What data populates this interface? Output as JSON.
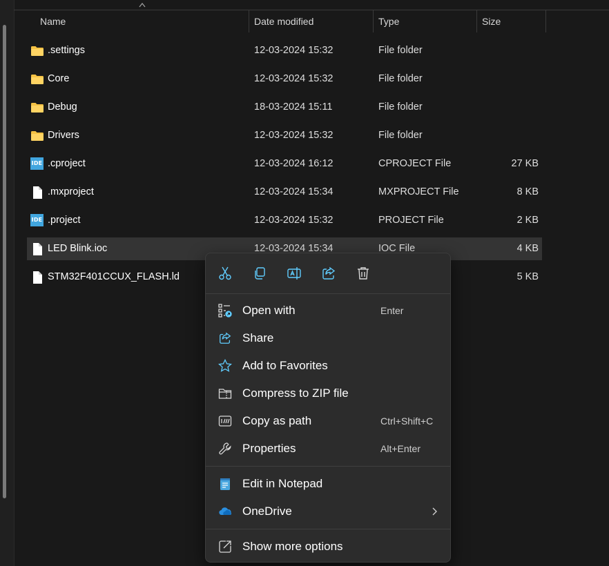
{
  "columns": {
    "name": "Name",
    "date": "Date modified",
    "type": "Type",
    "size": "Size"
  },
  "files": [
    {
      "name": ".settings",
      "date": "12-03-2024 15:32",
      "type": "File folder",
      "size": "",
      "icon": "folder-icon"
    },
    {
      "name": "Core",
      "date": "12-03-2024 15:32",
      "type": "File folder",
      "size": "",
      "icon": "folder-icon"
    },
    {
      "name": "Debug",
      "date": "18-03-2024 15:11",
      "type": "File folder",
      "size": "",
      "icon": "folder-icon"
    },
    {
      "name": "Drivers",
      "date": "12-03-2024 15:32",
      "type": "File folder",
      "size": "",
      "icon": "folder-icon"
    },
    {
      "name": ".cproject",
      "date": "12-03-2024 16:12",
      "type": "CPROJECT File",
      "size": "27 KB",
      "icon": "ide-file-icon",
      "badge": "IDE"
    },
    {
      "name": ".mxproject",
      "date": "12-03-2024 15:34",
      "type": "MXPROJECT File",
      "size": "8 KB",
      "icon": "file-icon"
    },
    {
      "name": ".project",
      "date": "12-03-2024 15:32",
      "type": "PROJECT File",
      "size": "2 KB",
      "icon": "ide-file-icon",
      "badge": "IDE"
    },
    {
      "name": "LED Blink.ioc",
      "date": "12-03-2024 15:34",
      "type": "IOC File",
      "size": "4 KB",
      "icon": "file-icon"
    },
    {
      "name": "STM32F401CCUX_FLASH.ld",
      "date": "",
      "type": "",
      "size": "5 KB",
      "icon": "file-icon"
    }
  ],
  "selected_index": 7,
  "context_menu": {
    "toolbar": [
      "cut-icon",
      "copy-icon",
      "rename-icon",
      "share-icon",
      "delete-icon"
    ],
    "items": [
      {
        "label": "Open with",
        "shortcut": "Enter",
        "icon": "open-with-icon"
      },
      {
        "label": "Share",
        "shortcut": "",
        "icon": "share-icon"
      },
      {
        "label": "Add to Favorites",
        "shortcut": "",
        "icon": "star-icon"
      },
      {
        "label": "Compress to ZIP file",
        "shortcut": "",
        "icon": "zip-folder-icon"
      },
      {
        "label": "Copy as path",
        "shortcut": "Ctrl+Shift+C",
        "icon": "copy-path-icon"
      },
      {
        "label": "Properties",
        "shortcut": "Alt+Enter",
        "icon": "wrench-icon"
      },
      {
        "label": "Edit in Notepad",
        "shortcut": "",
        "icon": "notepad-icon"
      },
      {
        "label": "OneDrive",
        "shortcut": "",
        "icon": "onedrive-icon"
      },
      {
        "label": "Show more options",
        "shortcut": "",
        "icon": "more-options-icon"
      }
    ]
  },
  "colors": {
    "background": "#191919",
    "menu": "#2c2c2c",
    "accent": "#60cdff",
    "folder": "#f5c244",
    "ide_badge": "#41a6df"
  }
}
